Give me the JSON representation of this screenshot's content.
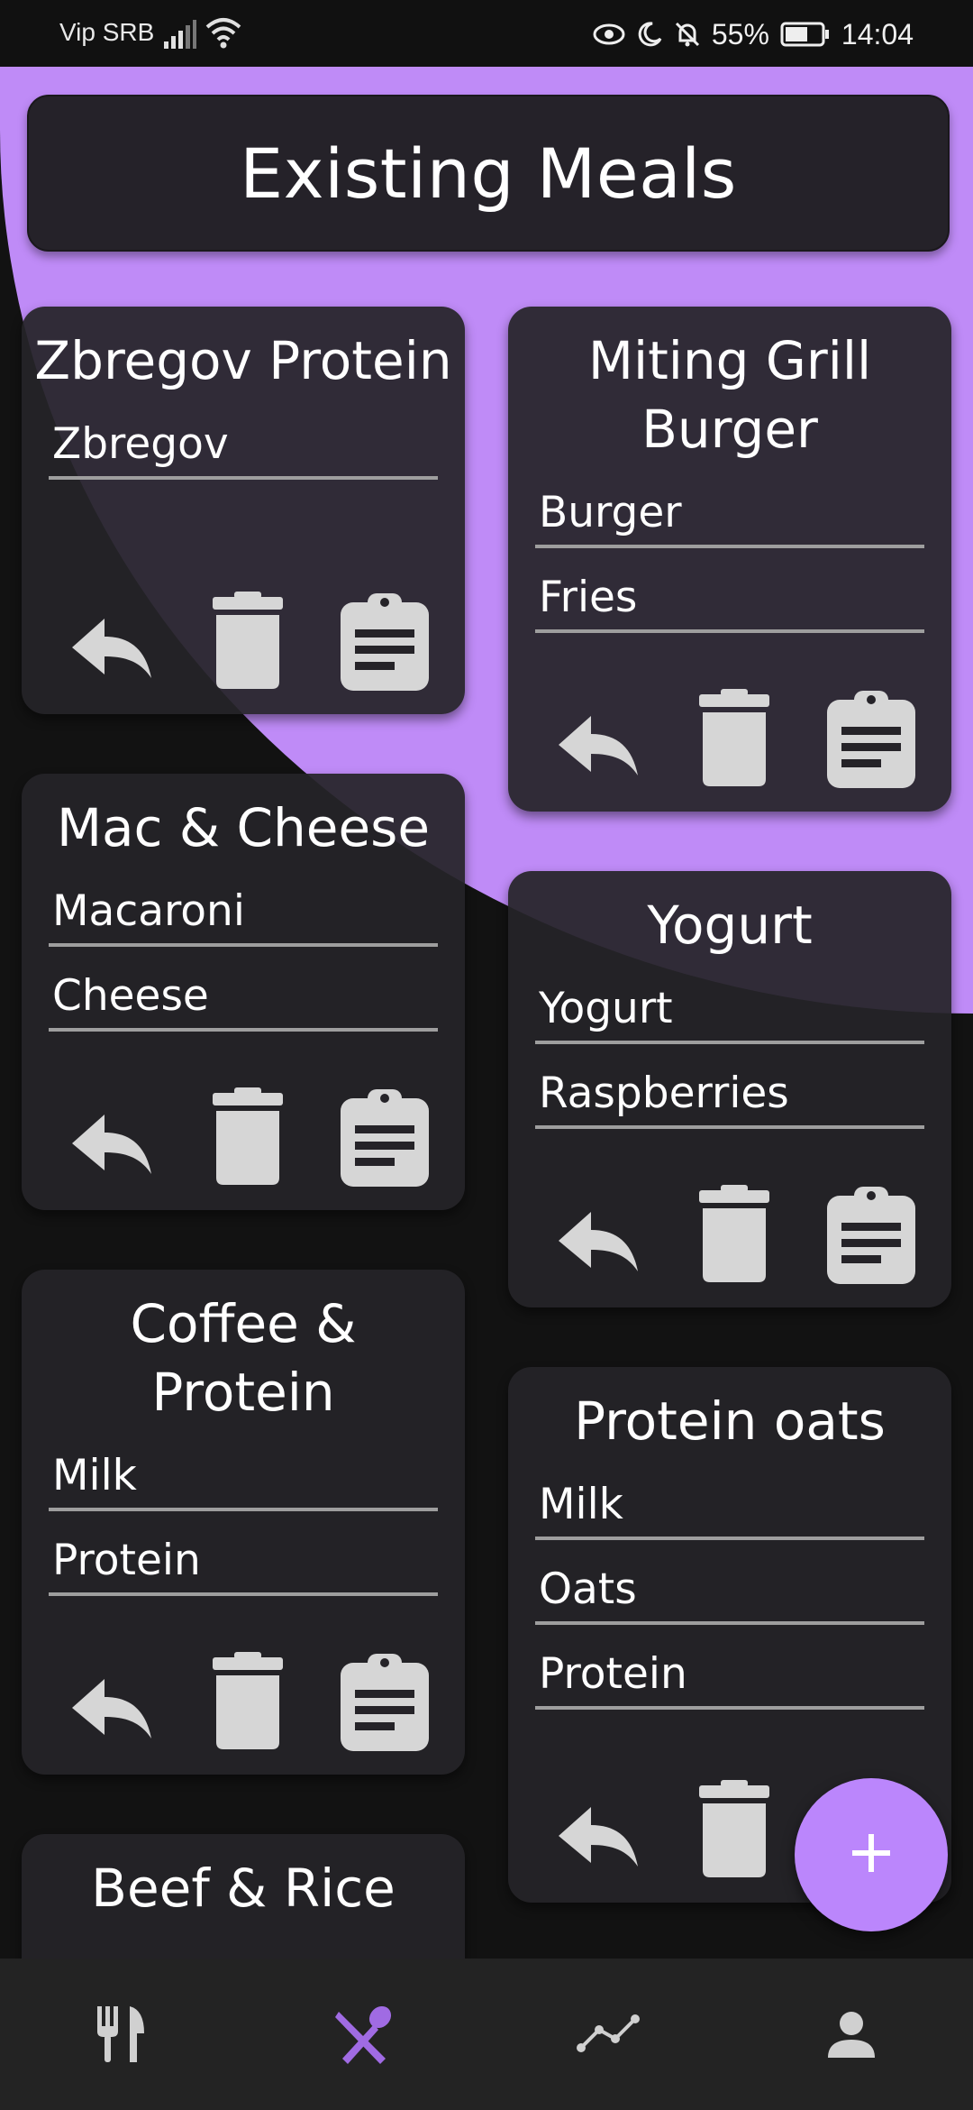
{
  "status_bar": {
    "carrier": "Vip SRB",
    "battery": "55%",
    "time": "14:04"
  },
  "header": {
    "title": "Existing Meals"
  },
  "meals": [
    {
      "title": "Zbregov Protein",
      "ingredients": [
        "Zbregov"
      ]
    },
    {
      "title": "Miting Grill Burger",
      "ingredients": [
        "Burger",
        "Fries"
      ]
    },
    {
      "title": "Mac & Cheese",
      "ingredients": [
        "Macaroni",
        "Cheese"
      ]
    },
    {
      "title": "Yogurt",
      "ingredients": [
        "Yogurt",
        "Raspberries"
      ]
    },
    {
      "title": "Coffee & Protein",
      "ingredients": [
        "Milk",
        "Protein"
      ]
    },
    {
      "title": "Protein oats",
      "ingredients": [
        "Milk",
        "Oats",
        "Protein"
      ]
    },
    {
      "title": "Beef & Rice",
      "ingredients": []
    }
  ],
  "card_icons": [
    "reply-icon",
    "delete-icon",
    "clipboard-icon"
  ],
  "fab": {
    "label": "+"
  },
  "bottom_nav": {
    "tabs": [
      "fork-knife-icon",
      "meals-icon",
      "stats-chart-icon",
      "profile-icon"
    ],
    "active_color": "#a06be3",
    "inactive_color": "#d0d0d0"
  },
  "colors": {
    "accent": "#bb86fc",
    "card": "#252328",
    "background": "#121212"
  }
}
